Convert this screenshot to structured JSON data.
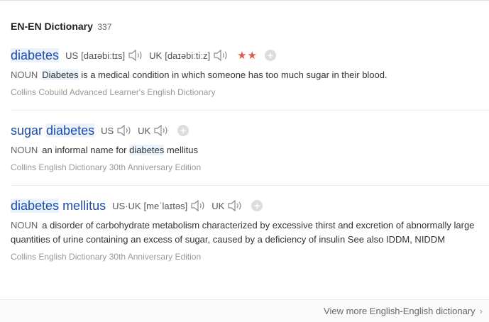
{
  "header": {
    "title": "EN-EN Dictionary",
    "count": "337"
  },
  "entries": [
    {
      "word_hl": "diabetes",
      "us_label": "US",
      "us_phon": "[daɪəbiːtɪs]",
      "uk_label": "UK",
      "uk_phon": "[daɪəbiːtiːz]",
      "stars": "★★",
      "pos": "NOUN",
      "def_hl": "Diabetes",
      "def_rest": " is a medical condition in which someone has too much sugar in their blood.",
      "source": "Collins Cobuild Advanced Learner's English Dictionary"
    },
    {
      "word_pre": "sugar ",
      "word_hl": "diabetes",
      "us_label": "US",
      "uk_label": "UK",
      "pos": "NOUN",
      "def_pre": "an informal name for ",
      "def_hl": "diabetes",
      "def_rest": " mellitus",
      "source": "Collins English Dictionary 30th Anniversary Edition"
    },
    {
      "word_hl": "diabetes",
      "word_post": " mellitus",
      "usuk_label": "US·UK",
      "usuk_phon": "[meˈlaɪtəs]",
      "uk_label": "UK",
      "pos": "NOUN",
      "def_rest": "a disorder of carbohydrate metabolism characterized by excessive thirst and excretion of abnormally large quantities of urine containing an excess of sugar, caused by a deficiency of insulin See also IDDM, NIDDM",
      "source": "Collins English Dictionary 30th Anniversary Edition"
    }
  ],
  "footer": {
    "more_label": "View more English-English dictionary",
    "chevron": "›"
  },
  "icons": {
    "speaker": "speaker-icon",
    "add": "plus-circle-icon"
  },
  "colors": {
    "word": "#1e4ca8",
    "highlight": "#eaf2fb",
    "stars": "#e05a4c"
  }
}
